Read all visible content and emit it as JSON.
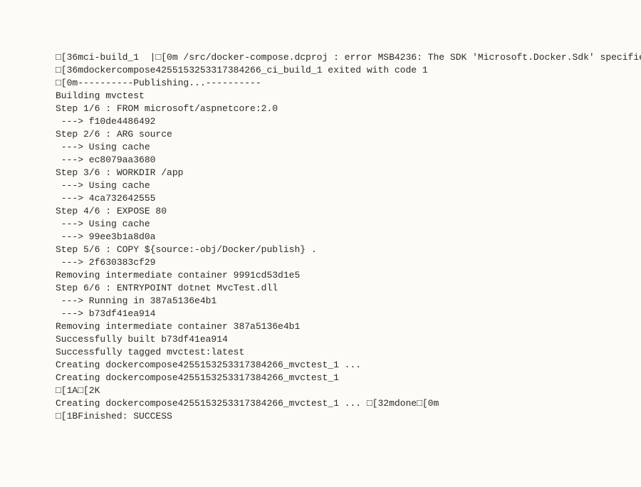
{
  "terminal": {
    "lines": [
      "□[36mci-build_1  |□[0m /src/docker-compose.dcproj : error MSB4236: The SDK 'Microsoft.Docker.Sdk' specified could not be found",
      "□[36mdockercompose4255153253317384266_ci_build_1 exited with code 1",
      "□[0m----------Publishing...----------",
      "Building mvctest",
      "Step 1/6 : FROM microsoft/aspnetcore:2.0",
      " ---> f10de4486492",
      "Step 2/6 : ARG source",
      " ---> Using cache",
      " ---> ec8079aa3680",
      "Step 3/6 : WORKDIR /app",
      " ---> Using cache",
      " ---> 4ca732642555",
      "Step 4/6 : EXPOSE 80",
      " ---> Using cache",
      " ---> 99ee3b1a8d0a",
      "Step 5/6 : COPY ${source:-obj/Docker/publish} .",
      " ---> 2f630383cf29",
      "Removing intermediate container 9991cd53d1e5",
      "Step 6/6 : ENTRYPOINT dotnet MvcTest.dll",
      " ---> Running in 387a5136e4b1",
      " ---> b73df41ea914",
      "Removing intermediate container 387a5136e4b1",
      "Successfully built b73df41ea914",
      "Successfully tagged mvctest:latest",
      "Creating dockercompose4255153253317384266_mvctest_1 ...",
      "Creating dockercompose4255153253317384266_mvctest_1",
      "□[1A□[2K",
      "Creating dockercompose4255153253317384266_mvctest_1 ... □[32mdone□[0m",
      "□[1BFinished: SUCCESS"
    ]
  }
}
